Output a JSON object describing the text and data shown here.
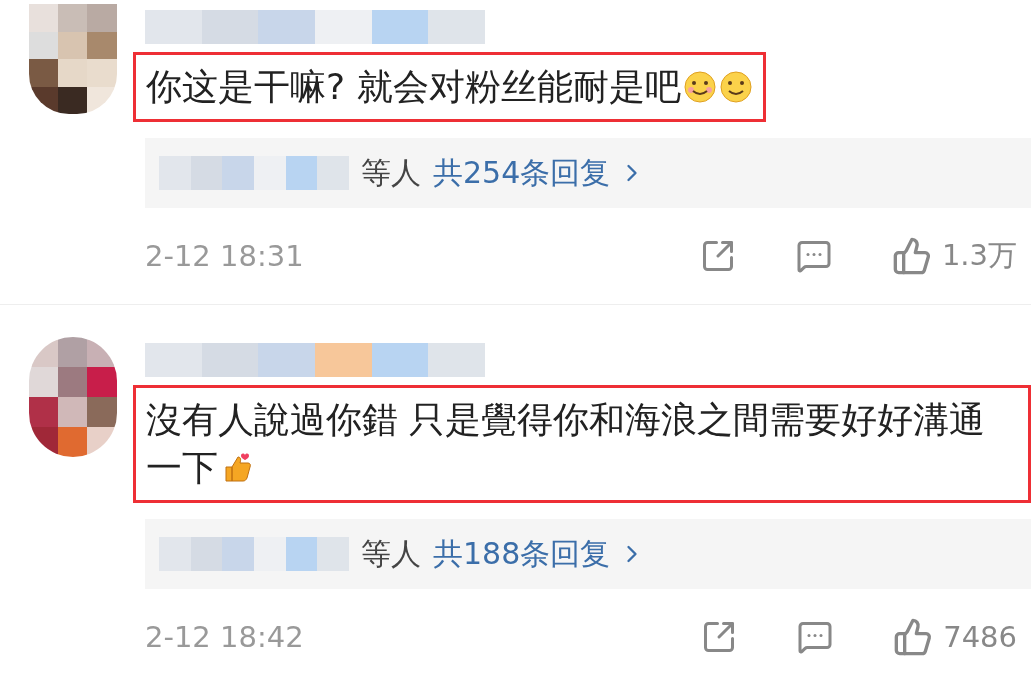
{
  "comments": [
    {
      "highlighted": true,
      "text": "你这是干嘛? 就会对粉丝能耐是吧",
      "kind": "smiles",
      "reply_suffix": "等人",
      "reply_link": "共254条回复",
      "time": "2-12 18:31",
      "likes": "1.3万"
    },
    {
      "highlighted": true,
      "text": "沒有人說過你錯 只是覺得你和海浪之間需要好好溝通一下",
      "kind": "thumbs",
      "reply_suffix": "等人",
      "reply_link": "共188条回复",
      "time": "2-12 18:42",
      "likes": "7486"
    }
  ]
}
